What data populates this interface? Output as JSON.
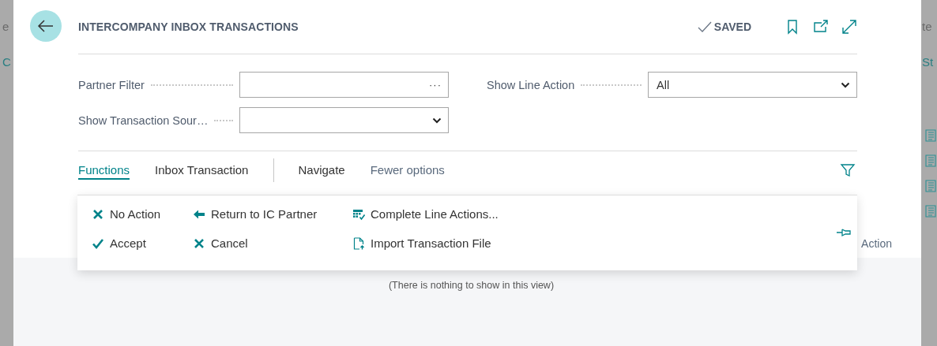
{
  "background": {
    "left_fragments": [
      "e",
      "C"
    ],
    "right_fragments": [
      "te",
      "St"
    ]
  },
  "header": {
    "title": "INTERCOMPANY INBOX TRANSACTIONS",
    "status": "SAVED"
  },
  "filters": [
    {
      "label": "Partner Filter",
      "kind": "lookup",
      "button_text": "···"
    },
    {
      "label": "Show Line Action",
      "kind": "select",
      "value": "All"
    },
    {
      "label": "Show Transaction Sour…",
      "kind": "select"
    }
  ],
  "action_tabs": [
    {
      "label": "Functions",
      "selected": true
    },
    {
      "label": "Inbox Transaction",
      "selected": false
    },
    {
      "label": "Navigate",
      "selected": false
    }
  ],
  "fewer_options": "Fewer options",
  "menu_columns": [
    [
      {
        "label": "No Action",
        "kind": "cross"
      },
      {
        "label": "Accept",
        "kind": "check"
      }
    ],
    [
      {
        "label": "Return to IC Partner",
        "kind": "arrow"
      },
      {
        "label": "Cancel",
        "kind": "cross"
      }
    ],
    [
      {
        "label": "Complete Line Actions...",
        "kind": "grid"
      },
      {
        "label": "Import Transaction File",
        "kind": "file"
      }
    ]
  ],
  "table": {
    "columns": [
      "Action"
    ],
    "empty_text": "(There is nothing to show in this view)"
  }
}
